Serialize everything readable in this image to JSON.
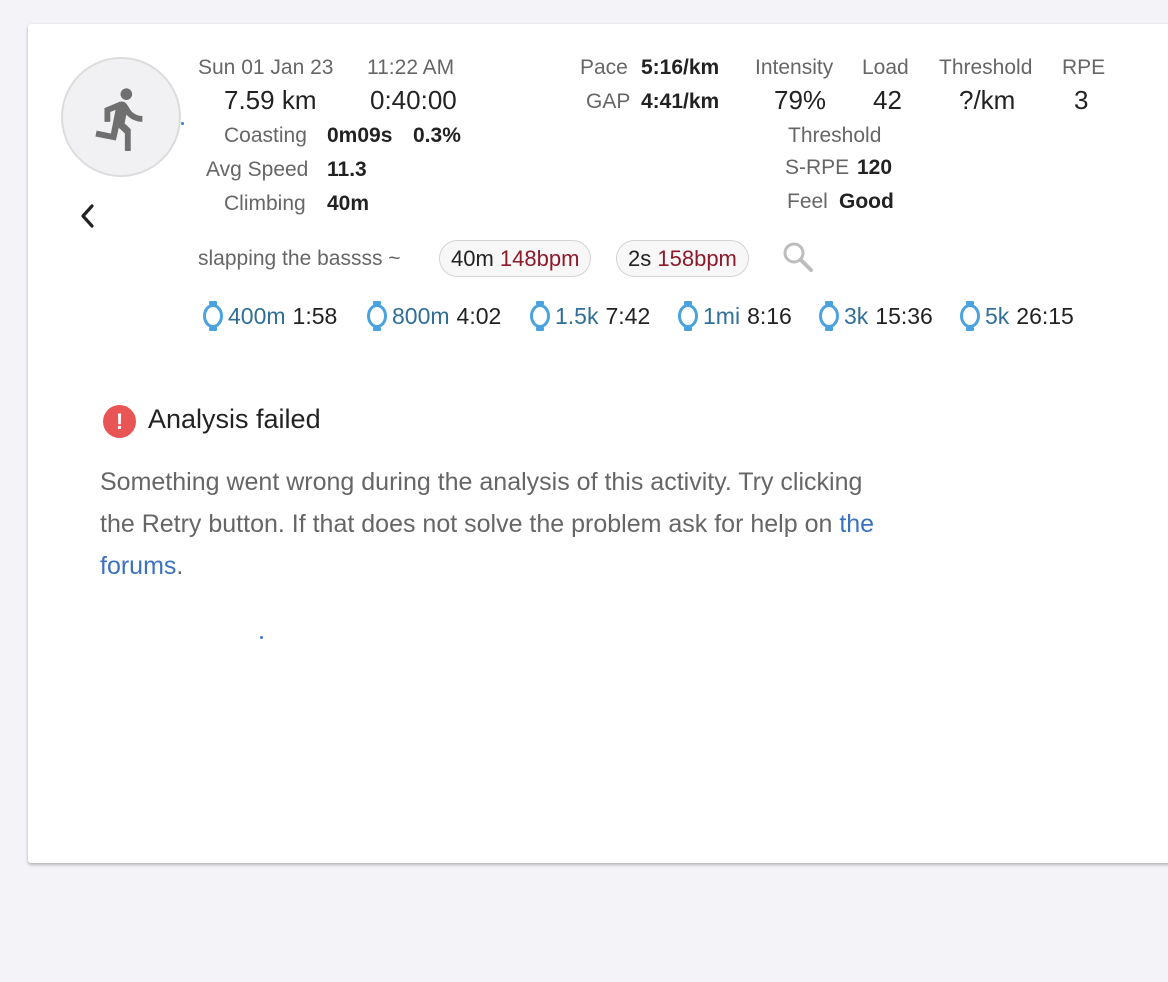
{
  "activity": {
    "icon": "running-person-icon",
    "date": "Sun 01 Jan 23",
    "time": "11:22 AM",
    "distance": "7.59 km",
    "duration": "0:40:00",
    "coasting": {
      "label": "Coasting",
      "time": "0m09s",
      "percent": "0.3%"
    },
    "avg_speed": {
      "label": "Avg Speed",
      "value": "11.3"
    },
    "climbing": {
      "label": "Climbing",
      "value": "40m"
    },
    "pace": {
      "label": "Pace",
      "value": "5:16/km"
    },
    "gap": {
      "label": "GAP",
      "value": "4:41/km"
    },
    "intensity": {
      "label": "Intensity",
      "value": "79%"
    },
    "load": {
      "label": "Load",
      "value": "42"
    },
    "threshold": {
      "label": "Threshold",
      "value": "?/km"
    },
    "rpe": {
      "label": "RPE",
      "value": "3"
    },
    "threshold_srpe": {
      "label1": "Threshold",
      "label2": "S-RPE",
      "value": "120"
    },
    "feel": {
      "label": "Feel",
      "value": "Good"
    },
    "name": "slapping the bassss ~",
    "hr_chips": [
      {
        "duration": "40m",
        "bpm": "148bpm"
      },
      {
        "duration": "2s",
        "bpm": "158bpm"
      }
    ],
    "best_efforts": [
      {
        "distance": "400m",
        "time": "1:58"
      },
      {
        "distance": "800m",
        "time": "4:02"
      },
      {
        "distance": "1.5k",
        "time": "7:42"
      },
      {
        "distance": "1mi",
        "time": "8:16"
      },
      {
        "distance": "3k",
        "time": "15:36"
      },
      {
        "distance": "5k",
        "time": "26:15"
      }
    ]
  },
  "error": {
    "title": "Analysis failed",
    "icon_text": "!",
    "message": "Something went wrong during the analysis of this activity. Try clicking the Retry button. If that does not solve the problem ask for help on ",
    "link_text": "the forums",
    "after_link": "."
  },
  "colors": {
    "background": "#f3f3f8",
    "link": "#3a72c0",
    "heart_rate": "#8b1a2b",
    "best_effort_distance": "#2f6f98",
    "stopwatch": "#4aa3df",
    "error_icon": "#e95454"
  }
}
